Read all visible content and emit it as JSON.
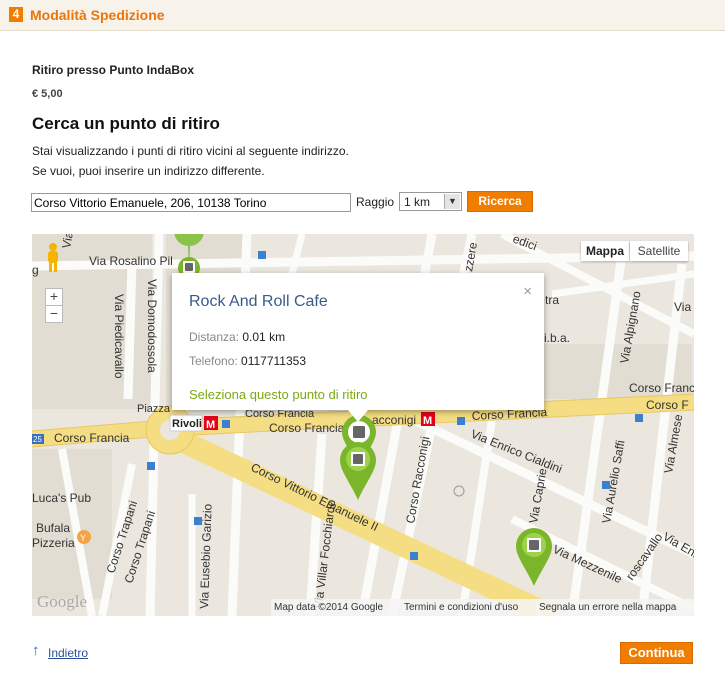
{
  "step": {
    "number": "4",
    "title": "Modalità Spedizione"
  },
  "method": {
    "title": "Ritiro presso Punto IndaBox",
    "price": "€ 5,00"
  },
  "search": {
    "title": "Cerca un punto di ritiro",
    "info_line1": "Stai visualizzando i punti di ritiro vicini al seguente indirizzo.",
    "info_line2": "Se vuoi, puoi inserire un indirizzo differente.",
    "address_value": "Corso Vittorio Emanuele, 206, 10138 Torino",
    "radius_label": "Raggio",
    "radius_value": "1 km",
    "search_button": "Ricerca"
  },
  "map": {
    "type_buttons": [
      "Mappa",
      "Satellite"
    ],
    "zoom_in": "+",
    "zoom_out": "−",
    "streets": {
      "rosalino": "Via Rosalino Pil",
      "domodossola": "Via Domodossola",
      "piedicavallo": "Via Piedicavallo",
      "piazza": "Piazza",
      "rivoli": "Rivoli",
      "francia1": "Corso Francia",
      "francia2": "Corso Francia",
      "francia3": "Corso Francia",
      "francia4": "Corso Franc",
      "francia5": "Corso F",
      "racconigi_stop": "acconigi",
      "vittorio": "Corso Vittorio Emanuele II",
      "cialdini": "Via Enrico Cialdini",
      "caprie": "Via Caprie",
      "racconigi_corso": "Corso Racconigi",
      "alpignano": "Via Alpignano",
      "saffi": "Via Aurelio Saffi",
      "almese": "Via Almese",
      "enri": "Via Enri",
      "mezzenile": "Via Mezzenile",
      "roscavallo": "roscavallo",
      "focchiardo": "Via Villar Focchiardo",
      "garizio": "Via Eusebio Garizio",
      "trapani1": "Corso Trapani",
      "trapani2": "Corso Trapani",
      "lucas": "Luca's Pub",
      "bufala1": "Bufala",
      "bufala2": "Pizzeria",
      "dici": "edici",
      "zzere": "zzere",
      "tra": "tra",
      "via_r": "Via",
      "iba": "i.b.a.",
      "via_top": "Via",
      "g": "g"
    },
    "popup": {
      "name": "Rock And Roll Cafe",
      "distance_label": "Distanza:",
      "distance_value": "0.01 km",
      "phone_label": "Telefono:",
      "phone_value": "0117711353",
      "select_link": "Seleziona questo punto di ritiro",
      "close": "×"
    },
    "logo": "Google",
    "attribution": [
      "Map data ©2014 Google",
      "Termini e condizioni d'uso",
      "Segnala un errore nella mappa"
    ]
  },
  "footer": {
    "back": "Indietro",
    "continue": "Continua"
  }
}
